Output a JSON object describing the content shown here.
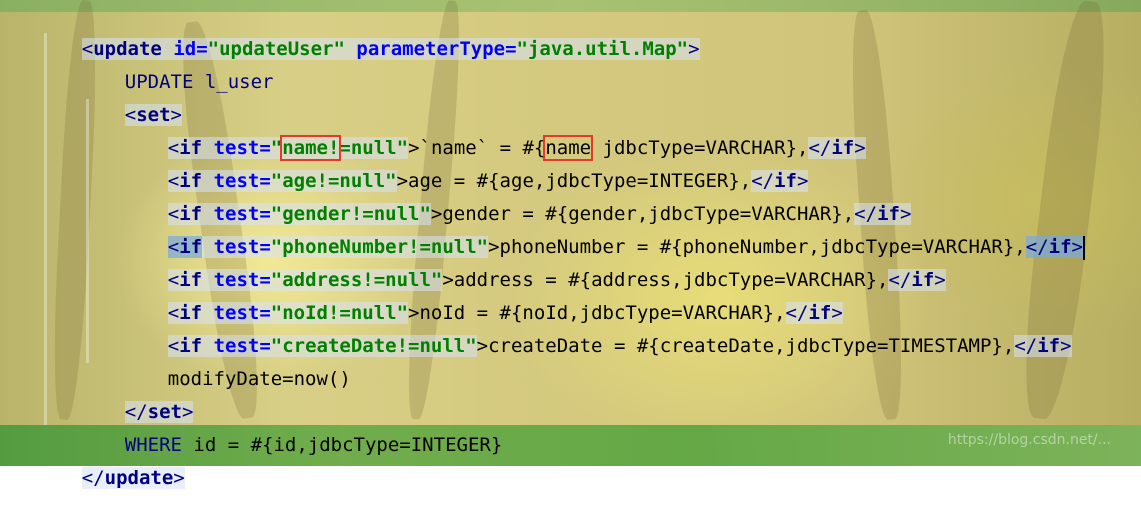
{
  "editor": {
    "lines": [
      {
        "id": "l1",
        "parts": [
          "<",
          "update",
          " ",
          "id=",
          "\"updateUser\"",
          " ",
          "parameterType=",
          "\"java.util.Map\"",
          ">"
        ]
      },
      {
        "id": "l2",
        "text": "UPDATE l_user"
      },
      {
        "id": "l3",
        "parts": [
          "<",
          "set",
          ">"
        ]
      },
      {
        "id": "l4",
        "parts": [
          "<",
          "if",
          " ",
          "test=",
          "\"",
          "name!",
          "=null\"",
          ">`name` = #{",
          "name",
          " jdbcType=VARCHAR},",
          "</",
          "if",
          ">"
        ]
      },
      {
        "id": "l5",
        "parts": [
          "<",
          "if",
          " ",
          "test=",
          "\"age!=null\"",
          ">age = #{age,jdbcType=INTEGER},",
          "</",
          "if",
          ">"
        ]
      },
      {
        "id": "l6",
        "parts": [
          "<",
          "if",
          " ",
          "test=",
          "\"gender!=null\"",
          ">gender = #{gender,jdbcType=VARCHAR},",
          "</",
          "if",
          ">"
        ]
      },
      {
        "id": "l7",
        "parts": [
          "<",
          "if",
          " ",
          "test=",
          "\"phoneNumber!=null\"",
          ">phoneNumber = #{phoneNumber,jdbcType=VARCHAR},",
          "</",
          "if",
          ">"
        ]
      },
      {
        "id": "l8",
        "parts": [
          "<",
          "if",
          " ",
          "test=",
          "\"address!=null\"",
          ">address = #{address,jdbcType=VARCHAR},",
          "</",
          "if",
          ">"
        ]
      },
      {
        "id": "l9",
        "parts": [
          "<",
          "if",
          " ",
          "test=",
          "\"noId!=null\"",
          ">noId = #{noId,jdbcType=VARCHAR},",
          "</",
          "if",
          ">"
        ]
      },
      {
        "id": "l10",
        "parts": [
          "<",
          "if",
          " ",
          "test=",
          "\"createDate!=null\"",
          ">createDate = #{createDate,jdbcType=TIMESTAMP},",
          "</",
          "if",
          ">"
        ]
      },
      {
        "id": "l11",
        "text": "modifyDate=now()"
      },
      {
        "id": "l12",
        "parts": [
          "</",
          "set",
          ">"
        ]
      },
      {
        "id": "l13",
        "parts": [
          "WHERE",
          " id = #{id,jdbcType=INTEGER}"
        ]
      },
      {
        "id": "l14",
        "parts": [
          "</",
          "update",
          ">"
        ]
      }
    ]
  },
  "watermark": "https://blog.csdn.net/...",
  "colors": {
    "tag": "#000080",
    "attribute": "#0000ff",
    "string": "#008000",
    "highlight_box": "#e23b2e"
  }
}
